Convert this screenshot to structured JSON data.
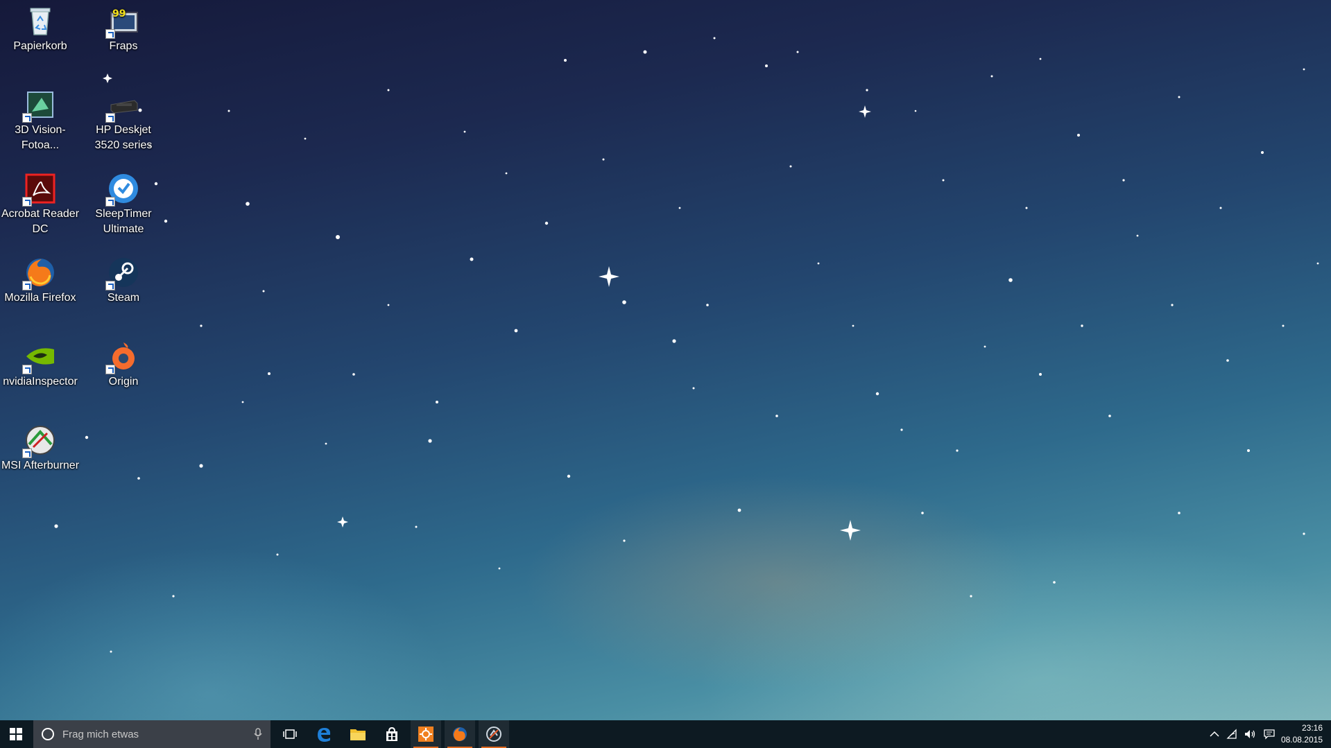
{
  "desktop_icons": [
    {
      "label": "Papierkorb",
      "icon": "recycle-bin-icon"
    },
    {
      "label": "Fraps",
      "icon": "fraps-icon"
    },
    {
      "label": "3D Vision-Fotoa...",
      "icon": "3d-vision-icon"
    },
    {
      "label": "HP Deskjet 3520 series",
      "icon": "printer-icon"
    },
    {
      "label": "Acrobat Reader DC",
      "icon": "acrobat-icon"
    },
    {
      "label": "SleepTimer Ultimate",
      "icon": "sleeptimer-icon"
    },
    {
      "label": "Mozilla Firefox",
      "icon": "firefox-icon"
    },
    {
      "label": "Steam",
      "icon": "steam-icon"
    },
    {
      "label": "nvidiaInspector",
      "icon": "nvidia-icon"
    },
    {
      "label": "Origin",
      "icon": "origin-icon"
    },
    {
      "label": "MSI Afterburner",
      "icon": "msi-afterburner-icon"
    }
  ],
  "taskbar": {
    "search_placeholder": "Frag mich etwas",
    "pinned": [
      "task-view-icon",
      "edge-icon",
      "file-explorer-icon",
      "store-icon",
      "orange-app-icon",
      "firefox-icon",
      "sleeptimer-icon"
    ],
    "active_apps": [
      "orange-app-icon",
      "firefox-icon",
      "sleeptimer-icon"
    ],
    "clock": {
      "time": "23:16",
      "date": "08.08.2015"
    }
  },
  "colors": {
    "taskbar": "#0d1a22",
    "search": "#3b4048",
    "accent_active": "#e06a20"
  }
}
